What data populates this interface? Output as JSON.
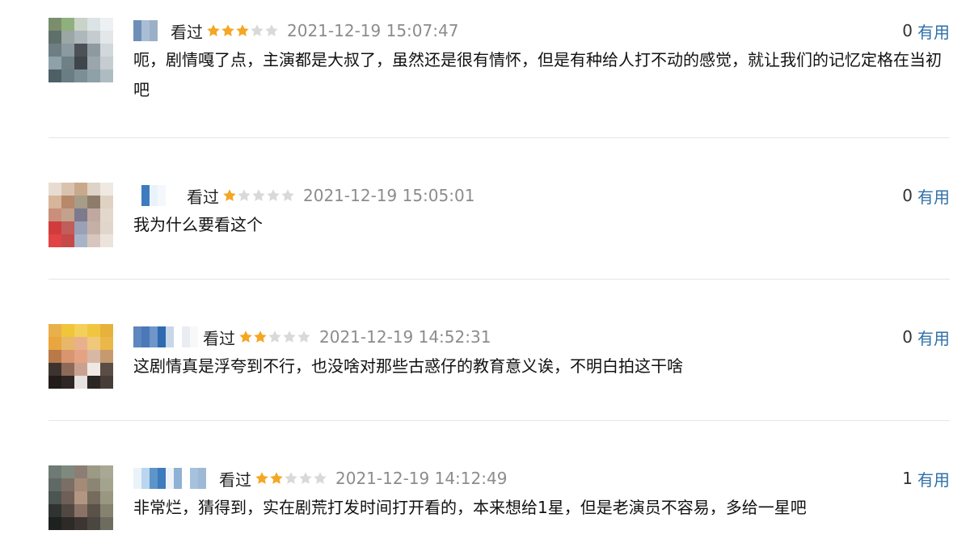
{
  "comments": [
    {
      "seen": "看过",
      "rating": 3,
      "time": "2021-12-19 15:07:47",
      "useful_count": "0",
      "useful_label": "有用",
      "text": "呃，剧情嘎了点，主演都是大叔了，虽然还是很有情怀，但是有种给人打不动的感觉，就让我们的记忆定格在当初吧"
    },
    {
      "seen": "看过",
      "rating": 1,
      "time": "2021-12-19 15:05:01",
      "useful_count": "0",
      "useful_label": "有用",
      "text": "我为什么要看这个"
    },
    {
      "seen": "看过",
      "rating": 2,
      "time": "2021-12-19 14:52:31",
      "useful_count": "0",
      "useful_label": "有用",
      "text": "这剧情真是浮夸到不行，也没啥对那些古惑仔的教育意义诶，不明白拍这干啥"
    },
    {
      "seen": "看过",
      "rating": 2,
      "time": "2021-12-19 14:12:49",
      "useful_count": "1",
      "useful_label": "有用",
      "text": "非常烂，猜得到，实在剧荒打发时间打开看的，本来想给1星，但是老演员不容易，多给一星吧"
    }
  ],
  "colors": {
    "star_on": "#f5a623",
    "star_off": "#d9d9d9",
    "link": "#2f70a8",
    "time": "#8c8c8c",
    "divider": "#e6e6e6"
  },
  "icons": {
    "star": "star-icon"
  }
}
